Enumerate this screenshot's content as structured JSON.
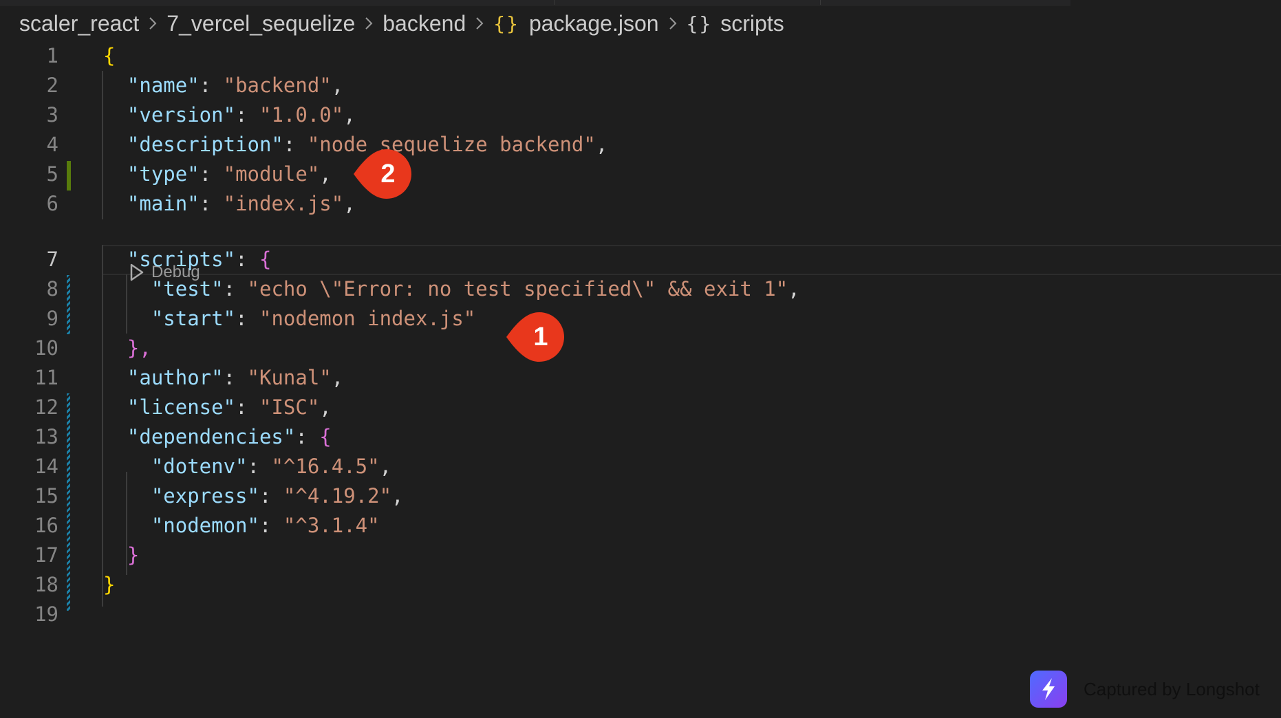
{
  "breadcrumb": {
    "segments": [
      "scaler_react",
      "7_vercel_sequelize",
      "backend",
      "package.json",
      "scripts"
    ],
    "json_icon": "{}",
    "object_icon": "{}"
  },
  "editor": {
    "line_numbers": [
      "1",
      "2",
      "3",
      "4",
      "5",
      "6",
      "7",
      "8",
      "9",
      "10",
      "11",
      "12",
      "13",
      "14",
      "15",
      "16",
      "17",
      "18",
      "19"
    ],
    "current_line": 7,
    "codelens_label": "Debug",
    "lines": [
      {
        "k": null,
        "v": null
      },
      {
        "k": "\"name\"",
        "v": "\"backend\""
      },
      {
        "k": "\"version\"",
        "v": "\"1.0.0\""
      },
      {
        "k": "\"description\"",
        "v": "\"node sequelize backend\""
      },
      {
        "k": "\"type\"",
        "v": "\"module\""
      },
      {
        "k": "\"main\"",
        "v": "\"index.js\""
      },
      {
        "k": "\"scripts\"",
        "v": null
      },
      {
        "k": "\"test\"",
        "v": "\"echo \\\"Error: no test specified\\\" && exit 1\""
      },
      {
        "k": "\"start\"",
        "v": "\"nodemon index.js\""
      },
      {
        "k": null,
        "v": null
      },
      {
        "k": "\"author\"",
        "v": "\"Kunal\""
      },
      {
        "k": "\"license\"",
        "v": "\"ISC\""
      },
      {
        "k": "\"dependencies\"",
        "v": null
      },
      {
        "k": "\"dotenv\"",
        "v": "\"^16.4.5\""
      },
      {
        "k": "\"express\"",
        "v": "\"^4.19.2\""
      },
      {
        "k": "\"nodemon\"",
        "v": "\"^3.1.4\""
      }
    ],
    "punctuation": {
      "open_brace": "{",
      "close_brace": "}",
      "close_brace_comma": "},",
      "colon": ": ",
      "comma": ","
    }
  },
  "annotations": {
    "marker_1": "1",
    "marker_2": "2",
    "color": "#e8371c"
  },
  "watermark": {
    "text": "Captured by Longshot"
  },
  "colors": {
    "background": "#1e1e1e",
    "key": "#9cdcfe",
    "string": "#ce9178",
    "brace_level1": "#ffd700",
    "brace_level2": "#da70d6",
    "gutter_added": "#587c0c",
    "gutter_modified": "#1b81a8"
  }
}
